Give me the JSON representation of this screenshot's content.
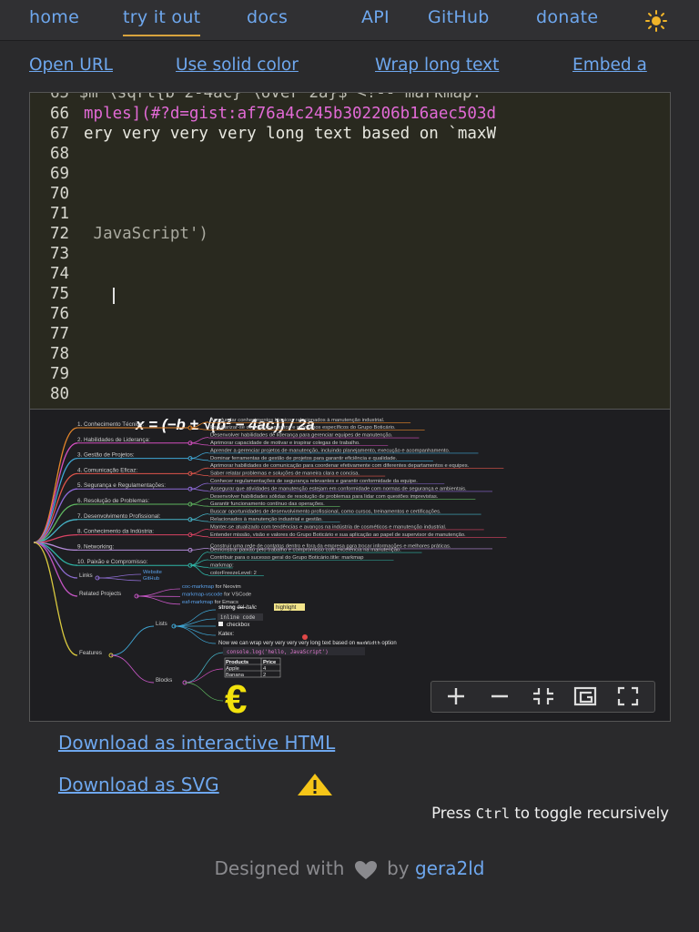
{
  "nav": {
    "home": "home",
    "try": "try it out",
    "docs": "docs",
    "api": "API",
    "github": "GitHub",
    "donate": "donate",
    "theme_icon": "sun-icon"
  },
  "toolbar": {
    "open_url": "Open URL",
    "solid_color": "Use solid color",
    "wrap_text": "Wrap long text",
    "embed": "Embed a"
  },
  "editor": {
    "partial_line": "65 $m \\sqrt{b^2-4ac} \\over 2a}$ <!-- markmap:",
    "line_numbers": [
      "66",
      "67",
      "68",
      "69",
      "70",
      "71",
      "72",
      "73",
      "74",
      "75",
      "76",
      "77",
      "78",
      "79",
      "80"
    ],
    "code_66": "mples](#?d=gist:af76a4c245b302206b16aec503d",
    "code_67": "ery very very very long text based on `maxW",
    "code_72": " JavaScript')"
  },
  "mindmap": {
    "formula": "x = (−b ± √(b² − 4ac)) / 2a",
    "branches": [
      {
        "label": "1. Conhecimento Técnico:",
        "children": [
          "Aprofundar conhecimentos técnicos relacionados à manutenção industrial.",
          "Familiarizar-se com equipamentos e processos específicos do Grupo Boticário."
        ]
      },
      {
        "label": "2. Habilidades de Liderança:",
        "children": [
          "Desenvolver habilidades de liderança para gerenciar equipes de manutenção.",
          "Aprimorar capacidade de motivar e inspirar colegas de trabalho."
        ]
      },
      {
        "label": "3. Gestão de Projetos:",
        "children": [
          "Aprender a gerenciar projetos de manutenção, incluindo planejamento, execução e acompanhamento.",
          "Dominar ferramentas de gestão de projetos para garantir eficiência e qualidade."
        ]
      },
      {
        "label": "4. Comunicação Eficaz:",
        "children": [
          "Aprimorar habilidades de comunicação para coordenar efetivamente com diferentes departamentos e equipes.",
          "Saber relatar problemas e soluções de maneira clara e concisa."
        ]
      },
      {
        "label": "5. Segurança e Regulamentações:",
        "children": [
          "Conhecer regulamentações de segurança relevantes e garantir conformidade da equipe.",
          "Assegurar que atividades de manutenção estejam em conformidade com normas de segurança e ambientais."
        ]
      },
      {
        "label": "6. Resolução de Problemas:",
        "children": [
          "Desenvolver habilidades sólidas de resolução de problemas para lidar com questões imprevistas.",
          "Garantir funcionamento contínuo das operações."
        ]
      },
      {
        "label": "7. Desenvolvimento Profissional:",
        "children": [
          "Buscar oportunidades de desenvolvimento profissional, como cursos, treinamentos e certificações.",
          "Relacionados à manutenção industrial e gestão."
        ]
      },
      {
        "label": "8. Conhecimento da Indústria:",
        "children": [
          "Manter-se atualizado com tendências e avanços na indústria de cosméticos e manutenção industrial.",
          "Entender missão, visão e valores do Grupo Boticário e sua aplicação ao papel de supervisor de manutenção."
        ]
      },
      {
        "label": "9. Networking:",
        "children": [
          "Construir uma rede de contatos dentro e fora da empresa para trocar informações e melhores práticas."
        ]
      },
      {
        "label": "10. Paixão e Compromisso:",
        "children": [
          "Demonstrar paixão pelo trabalho e compromisso com excelência na manutenção.",
          "Contribuir para o sucesso geral do Grupo Boticário.title: markmap",
          "markmap:",
          "colorFreezeLevel: 2"
        ]
      }
    ],
    "links": {
      "label": "Links",
      "children": [
        "Website",
        "GitHub"
      ]
    },
    "related": {
      "label": "Related Projects",
      "children": [
        [
          "coc-markmap",
          " for Neovim"
        ],
        [
          "markmap-vscode",
          " for VSCode"
        ],
        [
          "eaf-markmap",
          " for Emacs"
        ]
      ]
    },
    "features": {
      "label": "Features",
      "lists": "Lists",
      "list_items": {
        "strong": "strong",
        "del": "del",
        "italic": "italic",
        "highlight": "highlight",
        "inline_code": "inline code",
        "checkbox": "checkbox",
        "katex": "Katex:",
        "long": "Now we can wrap very very very very long text based on ",
        "maxwidth": "maxWidth",
        "option": " option"
      },
      "blocks": "Blocks",
      "code_block": "console.log('hello, JavaScript')",
      "table_head": [
        "Products",
        "Price"
      ],
      "table_rows": [
        [
          "Apple",
          "4"
        ],
        [
          "Banana",
          "2"
        ]
      ]
    },
    "controls": [
      "zoom-in-icon",
      "zoom-out-icon",
      "fit-icon",
      "recurse-icon",
      "fullscreen-icon"
    ]
  },
  "downloads": {
    "html": "Download as interactive HTML",
    "svg": "Download as SVG"
  },
  "hint": {
    "prefix": "Press ",
    "key": "Ctrl",
    "suffix": " to toggle recursively"
  },
  "footer": {
    "prefix": "Designed with",
    "by": "by",
    "author": "gera2ld"
  }
}
